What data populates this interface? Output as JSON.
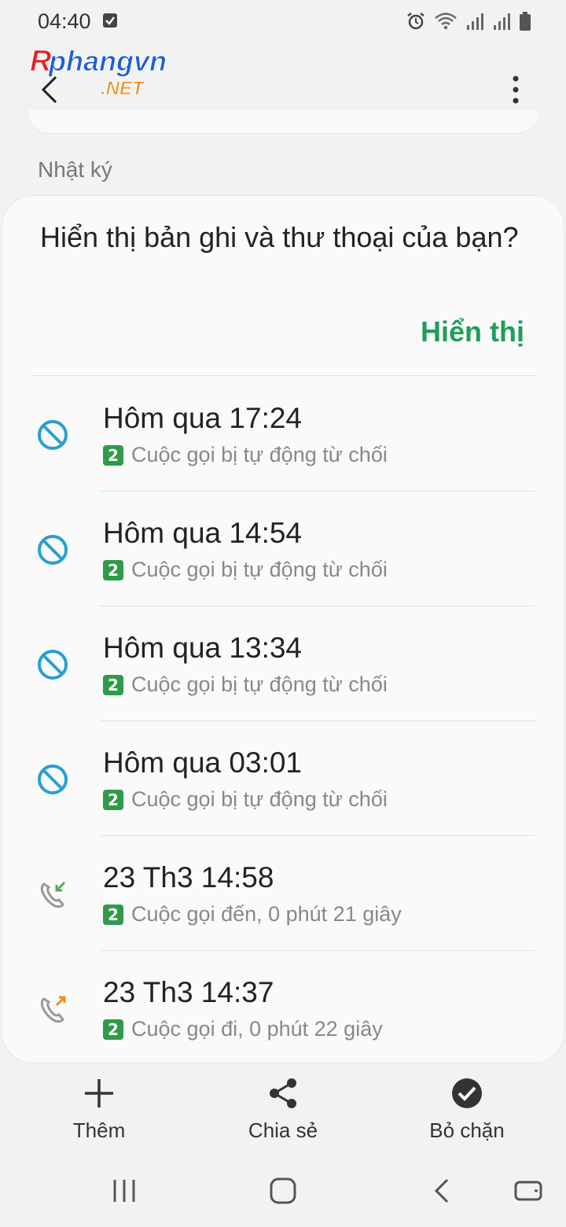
{
  "status_bar": {
    "time": "04:40"
  },
  "app_bar": {
    "logo_text_main": "Rphangvn",
    "logo_text_sub": ".NET"
  },
  "section": {
    "label": "Nhật ký"
  },
  "prompt": {
    "text": "Hiển thị bản ghi và thư thoại của bạn?",
    "action_label": "Hiển thị"
  },
  "logs": [
    {
      "time": "Hôm qua 17:24",
      "sim": "2",
      "desc": "Cuộc gọi bị tự động từ chối",
      "type": "blocked"
    },
    {
      "time": "Hôm qua 14:54",
      "sim": "2",
      "desc": "Cuộc gọi bị tự động từ chối",
      "type": "blocked"
    },
    {
      "time": "Hôm qua 13:34",
      "sim": "2",
      "desc": "Cuộc gọi bị tự động từ chối",
      "type": "blocked"
    },
    {
      "time": "Hôm qua 03:01",
      "sim": "2",
      "desc": "Cuộc gọi bị tự động từ chối",
      "type": "blocked"
    },
    {
      "time": "23 Th3 14:58",
      "sim": "2",
      "desc": "Cuộc gọi đến, 0 phút 21 giây",
      "type": "incoming"
    },
    {
      "time": "23 Th3 14:37",
      "sim": "2",
      "desc": "Cuộc gọi đi, 0 phút 22 giây",
      "type": "outgoing"
    }
  ],
  "actions": {
    "add_label": "Thêm",
    "share_label": "Chia sẻ",
    "unblock_label": "Bỏ chặn"
  },
  "colors": {
    "accent_green": "#1f9e5a",
    "blocked_blue": "#2a9fd0",
    "sim_green": "#2e9b49",
    "incoming_arrow": "#4caf50",
    "outgoing_arrow": "#f08c1e"
  }
}
